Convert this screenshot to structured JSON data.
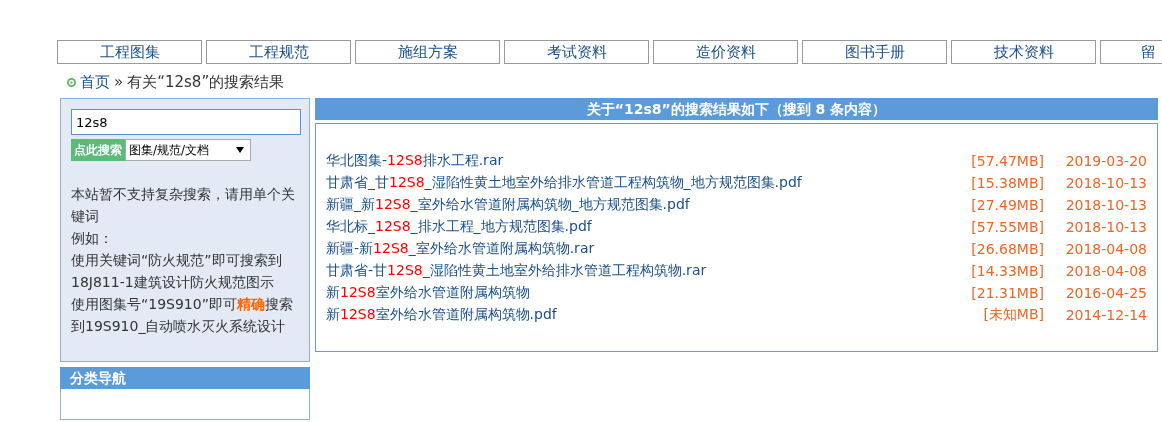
{
  "nav": [
    {
      "label": "工程图集"
    },
    {
      "label": "工程规范"
    },
    {
      "label": "施组方案"
    },
    {
      "label": "考试资料"
    },
    {
      "label": "造价资料"
    },
    {
      "label": "图书手册"
    },
    {
      "label": "技术资料"
    },
    {
      "label": "留"
    }
  ],
  "breadcrumb": {
    "home": "首页",
    "separator": "»",
    "current": "有关“12s8”的搜索结果"
  },
  "sidebar": {
    "search": {
      "value": "12s8"
    },
    "search_button": "点此搜索",
    "scope_select": {
      "value": "图集/规范/文档"
    },
    "help": [
      "本站暂不支持复杂搜索，请用单个关键词",
      "例如：",
      "使用关键词“防火规范”即可搜索到18J811-1建筑设计防火规范图示",
      "使用图集号“19S910”即可**精确**搜索到19S910_自动喷水灭火系统设计"
    ],
    "category_nav": {
      "title": "分类导航"
    }
  },
  "results": {
    "title": "关于“12s8”的搜索结果如下（搜到 8 条内容）",
    "rows": [
      {
        "name_parts": [
          {
            "text": "华北图集-",
            "highlight": false
          },
          {
            "text": "12S8",
            "highlight": true
          },
          {
            "text": "排水工程.rar",
            "highlight": false
          }
        ],
        "size": "[57.47MB]",
        "date": "2019-03-20"
      },
      {
        "name_parts": [
          {
            "text": "甘肃省_甘",
            "highlight": false
          },
          {
            "text": "12S8",
            "highlight": true
          },
          {
            "text": "_湿陷性黄土地室外给排水管道工程构筑物_地方规范图集.pdf",
            "highlight": false
          }
        ],
        "size": "[15.38MB]",
        "date": "2018-10-13"
      },
      {
        "name_parts": [
          {
            "text": "新疆_新",
            "highlight": false
          },
          {
            "text": "12S8",
            "highlight": true
          },
          {
            "text": "_室外给水管道附属构筑物_地方规范图集.pdf",
            "highlight": false
          }
        ],
        "size": "[27.49MB]",
        "date": "2018-10-13"
      },
      {
        "name_parts": [
          {
            "text": "华北标_",
            "highlight": false
          },
          {
            "text": "12S8",
            "highlight": true
          },
          {
            "text": "_排水工程_地方规范图集.pdf",
            "highlight": false
          }
        ],
        "size": "[57.55MB]",
        "date": "2018-10-13"
      },
      {
        "name_parts": [
          {
            "text": "新疆-新",
            "highlight": false
          },
          {
            "text": "12S8",
            "highlight": true
          },
          {
            "text": "_室外给水管道附属构筑物.rar",
            "highlight": false
          }
        ],
        "size": "[26.68MB]",
        "date": "2018-04-08"
      },
      {
        "name_parts": [
          {
            "text": "甘肃省-甘",
            "highlight": false
          },
          {
            "text": "12S8",
            "highlight": true
          },
          {
            "text": "_湿陷性黄土地室外给排水管道工程构筑物.rar",
            "highlight": false
          }
        ],
        "size": "[14.33MB]",
        "date": "2018-04-08"
      },
      {
        "name_parts": [
          {
            "text": "新",
            "highlight": false
          },
          {
            "text": "12S8",
            "highlight": true
          },
          {
            "text": "室外给水管道附属构筑物",
            "highlight": false
          }
        ],
        "size": "[21.31MB]",
        "date": "2016-04-25"
      },
      {
        "name_parts": [
          {
            "text": "新",
            "highlight": false
          },
          {
            "text": "12S8",
            "highlight": true
          },
          {
            "text": "室外给水管道附属构筑物.pdf",
            "highlight": false
          }
        ],
        "size": "[未知MB]",
        "date": "2014-12-14"
      }
    ]
  }
}
